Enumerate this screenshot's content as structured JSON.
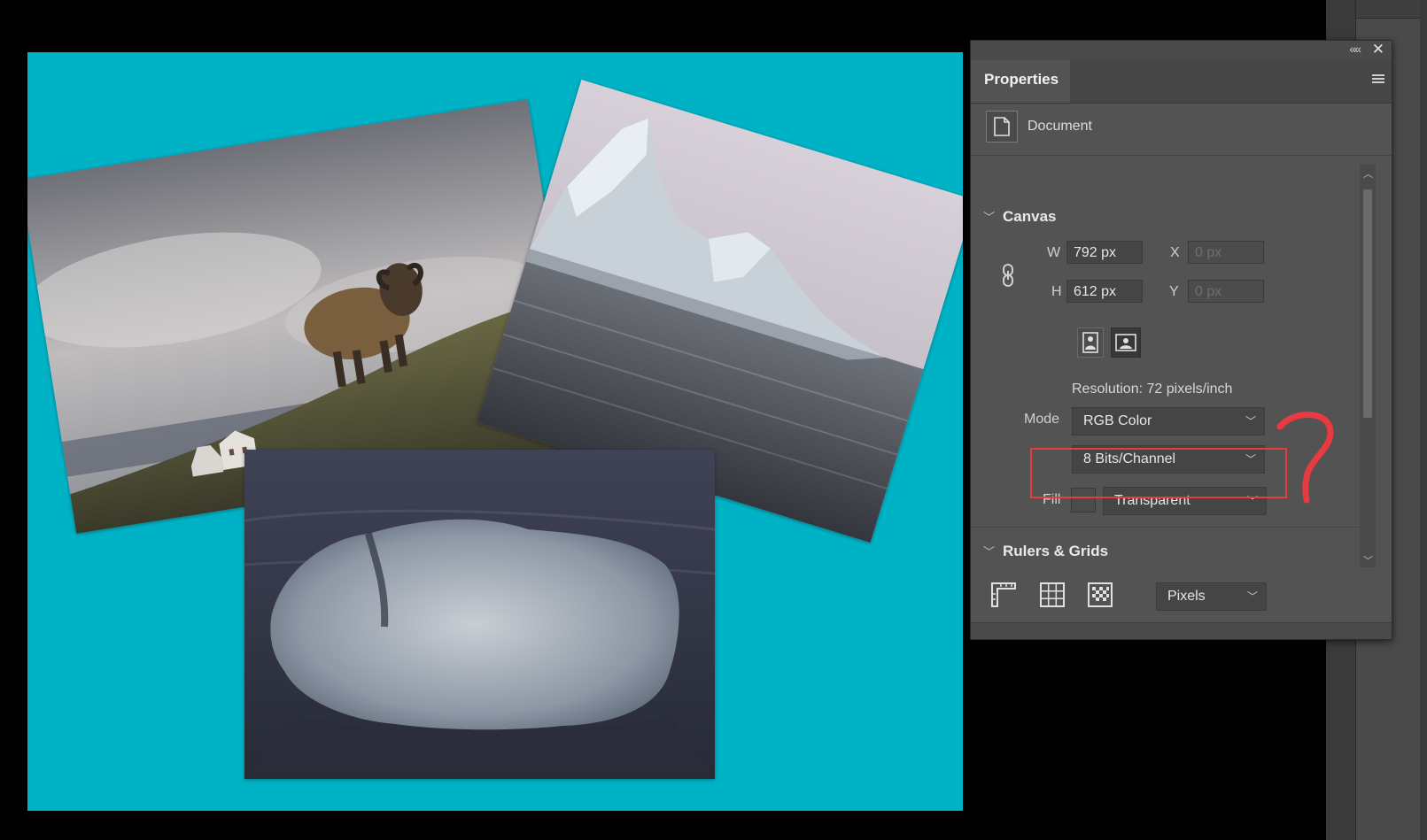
{
  "panel": {
    "tab_label": "Properties",
    "collapse_glyph": "««",
    "close_glyph": "✕",
    "doc_label": "Document"
  },
  "canvas_section": {
    "title": "Canvas",
    "w_label": "W",
    "w_value": "792 px",
    "h_label": "H",
    "h_value": "612 px",
    "x_label": "X",
    "x_value": "0 px",
    "y_label": "Y",
    "y_value": "0 px",
    "resolution": "Resolution: 72 pixels/inch",
    "mode_label": "Mode",
    "mode_value": "RGB Color",
    "bits_value": "8 Bits/Channel",
    "fill_label": "Fill",
    "fill_value": "Transparent"
  },
  "rulers_section": {
    "title": "Rulers & Grids",
    "units_value": "Pixels"
  },
  "colors": {
    "canvas_bg": "#00b2c6",
    "panel_bg": "#535353",
    "annotation": "#e73a41"
  },
  "icons": [
    "document-icon",
    "link-icon",
    "portrait-icon",
    "landscape-icon",
    "ruler-icon",
    "grid-icon",
    "guides-icon",
    "chevron-down-icon"
  ]
}
